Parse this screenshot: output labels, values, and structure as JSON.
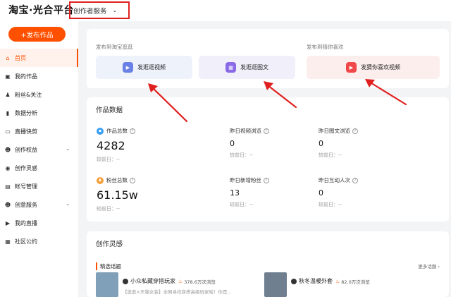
{
  "header": {
    "logo_text": "淘宝·光合平台",
    "service_dropdown": "创作者服务"
  },
  "sidebar": {
    "publish_button": "+发布作品",
    "items": [
      {
        "label": "首页",
        "icon": "home-icon",
        "glyph": "⌂",
        "active": true,
        "expandable": false
      },
      {
        "label": "我的作品",
        "icon": "works-icon",
        "glyph": "▣",
        "active": false,
        "expandable": false
      },
      {
        "label": "粉丝&关注",
        "icon": "fans-icon",
        "glyph": "♟",
        "active": false,
        "expandable": false
      },
      {
        "label": "数据分析",
        "icon": "chart-icon",
        "glyph": "▮",
        "active": false,
        "expandable": false
      },
      {
        "label": "直播快剪",
        "icon": "clip-icon",
        "glyph": "▭",
        "active": false,
        "expandable": false
      },
      {
        "label": "创作权益",
        "icon": "rights-icon",
        "glyph": "☻",
        "active": false,
        "expandable": true
      },
      {
        "label": "创作灵感",
        "icon": "inspiration-icon",
        "glyph": "◉",
        "active": false,
        "expandable": false
      },
      {
        "label": "帐号管理",
        "icon": "account-icon",
        "glyph": "▤",
        "active": false,
        "expandable": false
      },
      {
        "label": "创意服务",
        "icon": "creative-icon",
        "glyph": "☻",
        "active": false,
        "expandable": true
      },
      {
        "label": "我的直播",
        "icon": "live-icon",
        "glyph": "▶",
        "active": false,
        "expandable": false
      },
      {
        "label": "社区公约",
        "icon": "rules-icon",
        "glyph": "▦",
        "active": false,
        "expandable": false
      }
    ]
  },
  "publish": {
    "taobao_label": "发布到淘宝逛逛",
    "guess_label": "发布到猜你喜欢",
    "buttons": [
      {
        "label": "发逛逛视频",
        "icon": "play-icon",
        "glyph": "▶",
        "bg": "#eef2fb",
        "icon_color": "#6a80e6"
      },
      {
        "label": "发逛逛图文",
        "icon": "grid-icon",
        "glyph": "▦",
        "bg": "#f1effa",
        "icon_color": "#8a6ae6"
      },
      {
        "label": "发猜你喜欢视频",
        "icon": "video-icon",
        "glyph": "▶",
        "bg": "#fdeeee",
        "icon_color": "#f04848"
      }
    ]
  },
  "metrics": {
    "title": "作品数据",
    "items": [
      {
        "label": "作品总数",
        "value": "4282",
        "sub": "较前日：--",
        "big": true,
        "dot_color": "#3aa0f5",
        "dot_glyph": "▪"
      },
      {
        "label": "昨日视频浏览",
        "value": "0",
        "sub": "较前日：--",
        "big": false,
        "dot_color": "",
        "dot_glyph": ""
      },
      {
        "label": "昨日图文浏览",
        "value": "0",
        "sub": "较前日：--",
        "big": false,
        "dot_color": "",
        "dot_glyph": ""
      },
      {
        "label": "粉丝总数",
        "value": "61.15w",
        "sub": "较前日：--",
        "big": true,
        "dot_color": "#f5a03a",
        "dot_glyph": "♟"
      },
      {
        "label": "昨日新增粉丝",
        "value": "13",
        "sub": "较前日：--",
        "big": false,
        "dot_color": "",
        "dot_glyph": ""
      },
      {
        "label": "昨日互动人次",
        "value": "0",
        "sub": "较前日：--",
        "big": false,
        "dot_color": "",
        "dot_glyph": ""
      }
    ],
    "help_glyph": "?"
  },
  "inspiration": {
    "title": "创作灵感",
    "hot_topics_title": "精选话题",
    "more": "更多话题 ›",
    "topics": [
      {
        "name": "小众私藏穿搭玩家",
        "views": "378.6万次浏览",
        "desc": "【逛逛×天猫女装】全网寻找穿搭高级玩家啦！你是...",
        "thumb_color": "#7fa0b8"
      },
      {
        "name": "秋冬温暖外套",
        "views": "82.0万次浏览",
        "desc": "",
        "thumb_color": "#6f7f8f"
      }
    ]
  },
  "colors": {
    "accent": "#ff5000",
    "annotation_red": "#e02020"
  }
}
